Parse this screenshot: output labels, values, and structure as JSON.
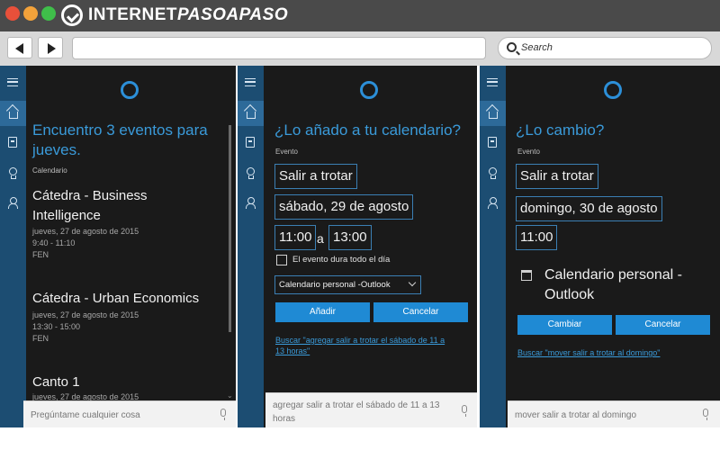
{
  "site": {
    "brand_part1": "INTERNET",
    "brand_part2": "PASOAPASO"
  },
  "browser": {
    "search_placeholder": "Search"
  },
  "panel1": {
    "heading_line1": "Encuentro 3 eventos para",
    "heading_line2": "jueves.",
    "section_label": "Calendario",
    "events": [
      {
        "title_line1": "Cátedra - Business",
        "title_line2": "Intelligence",
        "date": "jueves, 27 de agosto de 2015",
        "time": "9:40 - 11:10",
        "location": "FEN"
      },
      {
        "title_line1": "Cátedra - Urban Economics",
        "date": "jueves, 27 de agosto de 2015",
        "time": "13:30 - 15:00",
        "location": "FEN"
      },
      {
        "title_line1": "Canto 1",
        "date": "jueves, 27 de agosto de 2015"
      }
    ],
    "ask_placeholder": "Pregúntame cualquier cosa"
  },
  "panel2": {
    "heading": "¿Lo añado a tu calendario?",
    "event_label": "Evento",
    "title_value": "Salir a trotar",
    "date_value": "sábado, 29 de agosto",
    "start_time": "11:00",
    "time_separator": "a",
    "end_time": "13:00",
    "allday_label": "El evento dura todo el día",
    "calendar_select": "Calendario personal -Outlook",
    "add_button": "Añadir",
    "cancel_button": "Cancelar",
    "search_link_line1": "Buscar \"agregar salir a trotar el sábado de 11 a",
    "search_link_line2": "13 horas\"",
    "query_line1": "agregar salir a trotar el sábado de 11 a 13",
    "query_line2": "horas"
  },
  "panel3": {
    "heading": "¿Lo cambio?",
    "event_label": "Evento",
    "title_value": "Salir a trotar",
    "date_value": "domingo, 30 de agosto",
    "time_value": "11:00",
    "calendar_line1": "Calendario personal -",
    "calendar_line2": "Outlook",
    "change_button": "Cambiar",
    "cancel_button": "Cancelar",
    "search_link": "Buscar \"mover salir a trotar al domingo\"",
    "query": "mover salir a trotar al domingo"
  },
  "colors": {
    "accent": "#2c8fd8",
    "panel_bg": "#1a1a1a",
    "rail_bg": "#1c4d72",
    "button_bg": "#1f8ad4"
  }
}
